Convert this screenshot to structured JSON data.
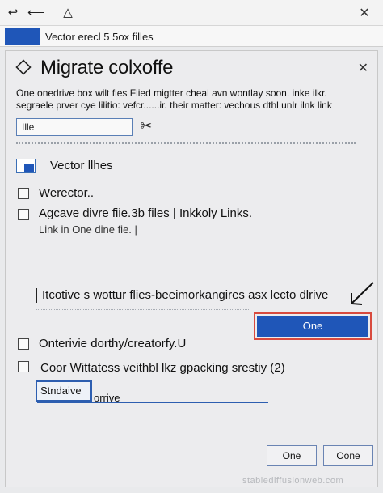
{
  "colors": {
    "accent": "#1f56b8",
    "highlight": "#d84a3e"
  },
  "titlebar": {
    "icons": [
      "back-icon",
      "minus-icon",
      "warning-icon",
      "close-icon"
    ],
    "back": "↩",
    "minus": "⟵",
    "warn": "△",
    "close": "✕"
  },
  "tab": {
    "label": "Vector erecl 5 5ox filles"
  },
  "dialog": {
    "title": "Migrate colxoffe",
    "close": "✕",
    "description": "One onedrive box wilt fies Flied migtter cheal avn wontlay soon. inke ilkr. segraele prver cye lilitio: vefcr......ir. their matter: vechous dthl unlr ilnk link",
    "input_value": "Ille",
    "scissors": "✂",
    "vector_files_label": "Vector llhes",
    "checkbox1_label": "Werector..",
    "checkbox2_label": "Agcave divre fiie.3b files | Inkkoly Links.",
    "checkbox2_sub": "Link in One dine fie. |",
    "info_text": "Itcotive s wottur flies-beeimorkangires asx lecto dlrive",
    "primary_button": "One",
    "checkbox3_label": "Onterivie dorthy/creatorfy.U",
    "checkbox4_label": "Coor Wittatess veithbl lkz gpacking srestiy (2)",
    "field2_value": "Stndaive",
    "field2_after": "orrive",
    "button_ok": "One",
    "button_cancel": "Oone"
  },
  "watermark": "stablediffusionweb.com"
}
